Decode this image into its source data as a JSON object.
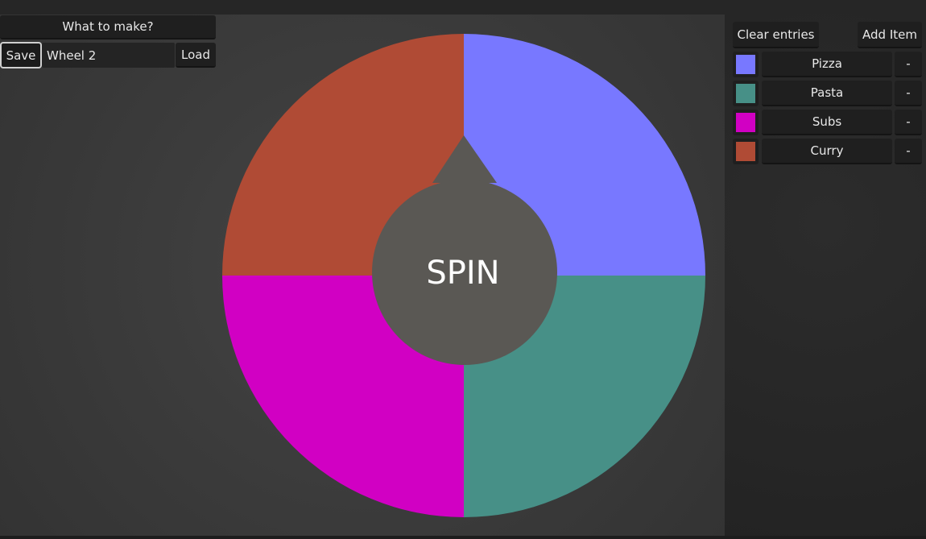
{
  "header": {
    "title_button": "What to make?"
  },
  "file": {
    "save_label": "Save",
    "wheel_name": "Wheel 2",
    "load_label": "Load"
  },
  "wheel": {
    "center_label": "SPIN",
    "segments": [
      {
        "label": "Pizza",
        "color": "#7878ff"
      },
      {
        "label": "Pasta",
        "color": "#479087"
      },
      {
        "label": "Subs",
        "color": "#d100c3"
      },
      {
        "label": "Curry",
        "color": "#b04b35"
      }
    ],
    "hub_color": "#5a5854"
  },
  "panel": {
    "clear_label": "Clear entries",
    "add_label": "Add Item",
    "entries": [
      {
        "name": "Pizza",
        "color": "#7878ff",
        "remove_label": "-"
      },
      {
        "name": "Pasta",
        "color": "#479087",
        "remove_label": "-"
      },
      {
        "name": "Subs",
        "color": "#d100c3",
        "remove_label": "-"
      },
      {
        "name": "Curry",
        "color": "#b04b35",
        "remove_label": "-"
      }
    ]
  }
}
